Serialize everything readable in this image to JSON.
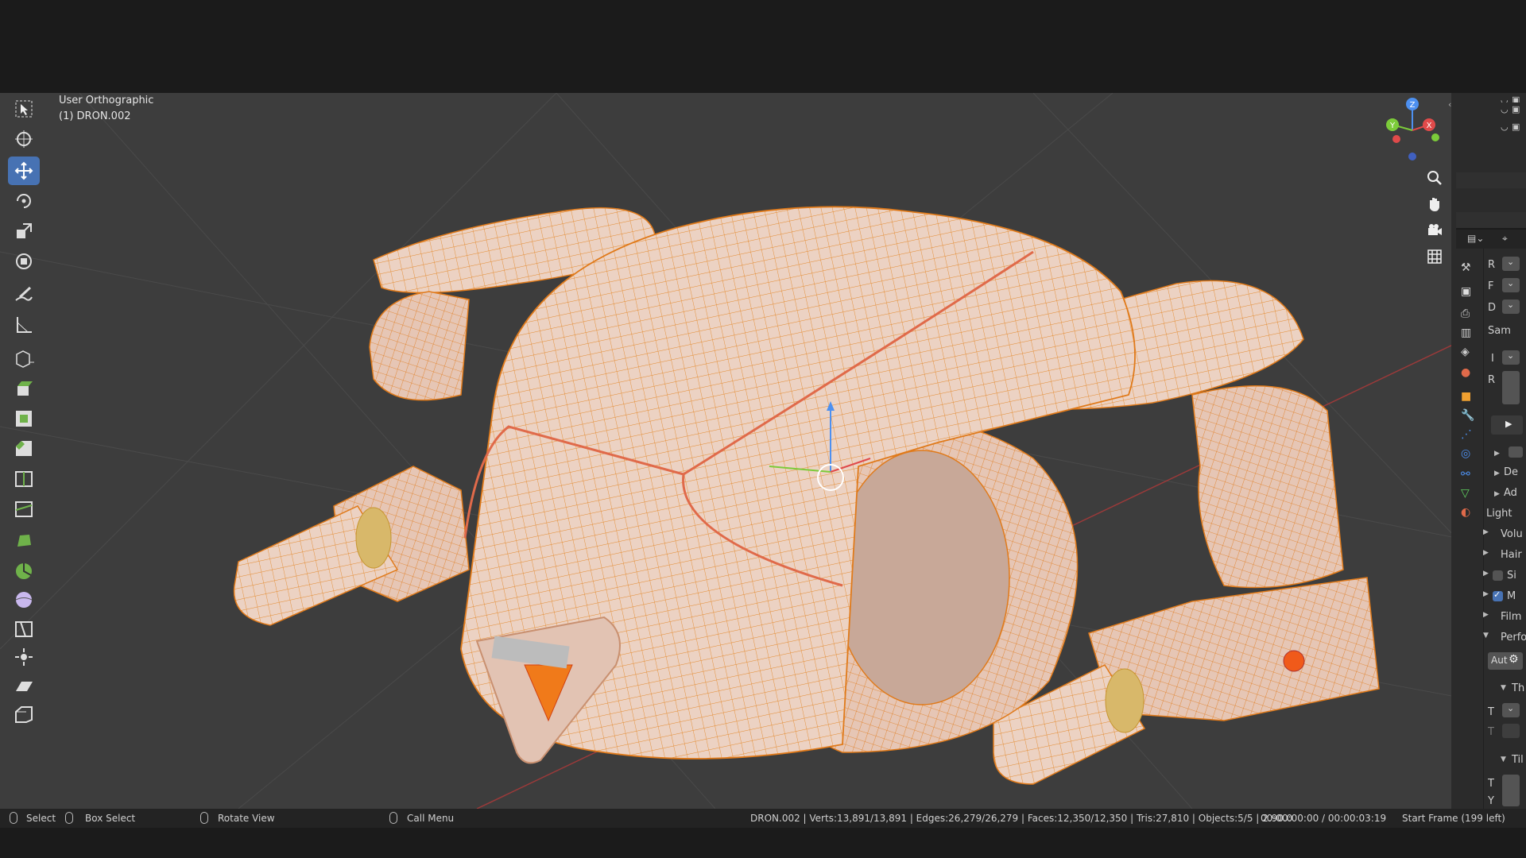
{
  "viewport": {
    "view_name": "User Orthographic",
    "object_label": "(1) DRON.002",
    "gizmo_axes": [
      "Z",
      "X",
      "Y"
    ]
  },
  "toolbar": {
    "tools": [
      "select-box-tool",
      "cursor-tool",
      "move-tool",
      "rotate-tool",
      "scale-tool",
      "transform-tool",
      "annotate-tool",
      "measure-tool",
      "add-cube-tool",
      "extrude-tool",
      "inset-tool",
      "bevel-tool",
      "loop-cut-tool",
      "knife-tool",
      "poly-build-tool",
      "spin-tool",
      "smooth-tool",
      "edge-slide-tool",
      "shrink-fatten-tool",
      "shear-tool",
      "rip-tool"
    ],
    "active": "move-tool"
  },
  "properties": {
    "rows": [
      {
        "label": "R"
      },
      {
        "label": "F"
      },
      {
        "label": "D"
      },
      {
        "label": "Sam"
      },
      {
        "label": "I"
      },
      {
        "label": "R"
      }
    ],
    "panels": [
      {
        "label": "De"
      },
      {
        "label": "Ad"
      },
      {
        "label": "Light"
      },
      {
        "label": "Volu"
      },
      {
        "label": "Hair"
      },
      {
        "label": "Si"
      },
      {
        "label": "M"
      },
      {
        "label": "Film"
      },
      {
        "label": "Perfo"
      }
    ],
    "auto_label": "Aut",
    "sub_panels": [
      {
        "label": "Th"
      },
      {
        "label": "Til"
      }
    ],
    "fields": [
      {
        "label": "T"
      },
      {
        "label": "T"
      },
      {
        "label": "T"
      },
      {
        "label": "Y"
      }
    ]
  },
  "statusbar": {
    "select": "Select",
    "box_select": "Box Select",
    "rotate_view": "Rotate View",
    "call_menu": "Call Menu",
    "stats": "DRON.002 | Verts:13,891/13,891 | Edges:26,279/26,279 | Faces:12,350/12,350 | Tris:27,810 | Objects:5/5 | 2.90.0",
    "timecode": "00:00:00:00 / 00:00:03:19",
    "start_frame": "Start Frame (199 left)"
  },
  "colors": {
    "accent": "#4772b3",
    "model_fill": "#e9cbbb",
    "wire": "#e07a1a",
    "viewport_bg": "#3d3d3d"
  }
}
